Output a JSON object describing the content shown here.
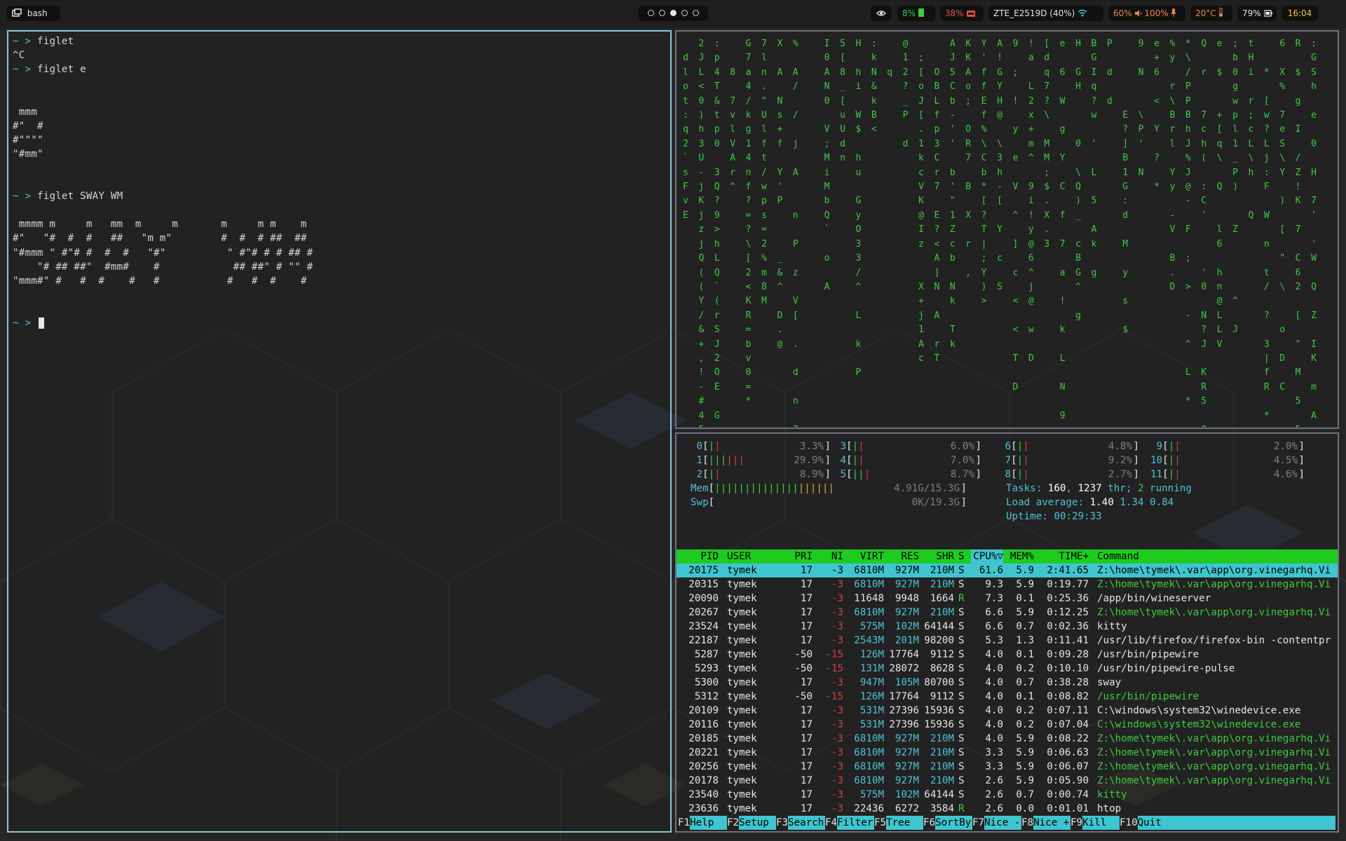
{
  "topbar": {
    "window_title": "bash",
    "workspaces": [
      {
        "active": false
      },
      {
        "active": false
      },
      {
        "active": true
      },
      {
        "active": false
      },
      {
        "active": false
      }
    ],
    "status": {
      "cpu": "8%",
      "mem": "38%",
      "network": "ZTE_E2519D (40%)",
      "volume_brightness": "60%",
      "volume": "100%",
      "temperature": "20°C",
      "battery": "79%",
      "clock": "16:04"
    },
    "colors": {
      "green": "#3fcb3f",
      "red": "#e0504c",
      "orange": "#e8884a",
      "accent": "#4fc1d7"
    }
  },
  "left_terminal": {
    "lines": [
      {
        "prompt": "~ > ",
        "text": "figlet"
      },
      {
        "prompt": "",
        "text": "^C"
      },
      {
        "prompt": "~ > ",
        "text": "figlet e"
      },
      {
        "prompt": "",
        "text": ""
      },
      {
        "prompt": "",
        "text": ""
      },
      {
        "prompt": "",
        "text": " mmm"
      },
      {
        "prompt": "",
        "text": "#\"  #"
      },
      {
        "prompt": "",
        "text": "#\"\"\"\""
      },
      {
        "prompt": "",
        "text": "\"#mm\""
      },
      {
        "prompt": "",
        "text": ""
      },
      {
        "prompt": "",
        "text": ""
      },
      {
        "prompt": "~ > ",
        "text": "figlet SWAY WM"
      },
      {
        "prompt": "",
        "text": ""
      },
      {
        "prompt": "",
        "text": " mmmm m     m   mm  m     m       m     m m    m"
      },
      {
        "prompt": "",
        "text": "#\"   \"#  #  #   ##   \"m m\"        #  #  # ##  ##"
      },
      {
        "prompt": "",
        "text": "\"#mmm \" #\"# #  #  #   \"#\"          \" #\"# # # ## #"
      },
      {
        "prompt": "",
        "text": "    \"# ## ##\"  #mm#    #            ## ##\" # \"\" #"
      },
      {
        "prompt": "",
        "text": "\"mmm#\" #   #  #    #   #           #   #  #    #"
      },
      {
        "prompt": "",
        "text": ""
      },
      {
        "prompt": "",
        "text": ""
      },
      {
        "prompt": "~ > ",
        "text": ""
      }
    ]
  },
  "matrix": {
    "columns": [
      " dlot:q2`sFvE",
      "2JL<0)h3U-jKjzjQ((Y/&+,!-#45",
      ":p4T&tp0 3Q?9>hLQ`(rSJ2OE G",
      "  8 7vlVAr^ ",
      "G7a4/kg14nf?=?\\[2<KR=bv0=*",
      "7ln.\"Ulft/wps=2%m8M",
      "X A Ns+f Y'P   _&^ D.@",
      "% A/ / j A  n P z V[ . d n 7 H",
      " ",
      "I0AN0 V;MiMbQ` o A",
      "5[8_[uUdn",
      "H hi W$ hu GyO33/^ L k P",
      ":kN&kB<",
      "  q ",
      "@12?_P d ",
      " ;[oJ[.1kcVK@Iz  X+j1Ac",
      "  OBLfp3Cr7 E?<A]N A rT",
      "AJ5Cb-'' b'\"1Zcb Nk Tk ",
      "KKAo; OR7 B X r ,",
      "Y'ffEf%\\Cb*[?T|;Y)>",
      "A!GYH@ \\3h-[ Y c S",
      "9 ; ! y e V ^ ] c < < T D",
      "!a L2x+m^ 9i!y@6^j@ w D",
      "[dq7?\\ MM;$.X.3",
      "e 6 W g Y C f 7 a ! k L N 9 8",
      "H GH   0 \\Q)_ cBG^ g",
      "BGIq?w ' L 5 Ak g",
      "P d d ",
      "     E?]B1G:d M y s $",
      "9 N  \\P' N",
      "e+6 < Y ? *",
      "%y r\\Brl Yy -V B.D",
      "*\\/PPBhJ%J@- F ; > - ^ L *",
      "Q r  7ch( :C'   '0 N?J KR5 8",
      "e $  +[q\\ Q  l6 hn@LLV",
      ";b0gwpl1_P)  Z    ^ J",
      "tHi r;cL\\h  Q",
      "  * [w?Lj:F W n t/ ? 3|fR * l ? +",
      "6 X% 7eS\\Y ) [ \" \\  o D C  ; ,",
      "R $ g I /Z!K 7 C62 [ \" M 5 5 D @",
      ":GSh e 0 H 7' 'W Q Z IK m A O w +"
    ]
  },
  "htop": {
    "cpus": [
      {
        "id": "0",
        "bar": "||",
        "pct": "3.3%"
      },
      {
        "id": "1",
        "bar": "||||||",
        "pct": "29.9%"
      },
      {
        "id": "2",
        "bar": "||",
        "pct": "8.9%"
      },
      {
        "id": "3",
        "bar": "||",
        "pct": "6.0%"
      },
      {
        "id": "4",
        "bar": "||",
        "pct": "7.0%"
      },
      {
        "id": "5",
        "bar": "|||",
        "pct": "8.7%"
      },
      {
        "id": "6",
        "bar": "||",
        "pct": "4.8%"
      },
      {
        "id": "7",
        "bar": "||",
        "pct": "9.2%"
      },
      {
        "id": "8",
        "bar": "||",
        "pct": "2.7%"
      },
      {
        "id": "9",
        "bar": "||",
        "pct": "2.0%"
      },
      {
        "id": "10",
        "bar": "||",
        "pct": "4.5%"
      },
      {
        "id": "11",
        "bar": "||",
        "pct": "4.6%"
      }
    ],
    "mem": {
      "label": "Mem",
      "value": "4.91G/15.3G"
    },
    "swp": {
      "label": "Swp",
      "value": "0K/19.3G"
    },
    "tasks": {
      "label": "Tasks:",
      "count": "160",
      "sep": ",",
      "thr": "1237",
      "thr_label": "thr;",
      "running": "2",
      "running_label": "running"
    },
    "load": {
      "label": "Load average:",
      "v1": "1.40",
      "v2": "1.34",
      "v3": "0.84"
    },
    "uptime": {
      "label": "Uptime:",
      "value": "00:29:33"
    },
    "columns": [
      "PID",
      "USER",
      "PRI",
      "NI",
      "VIRT",
      "RES",
      "SHR",
      "S",
      "CPU%▽",
      "MEM%",
      "TIME+",
      "Command"
    ],
    "processes": [
      {
        "pid": "20175",
        "user": "tymek",
        "pri": "17",
        "ni": "-3",
        "virt": "6810M",
        "res": "927M",
        "shr": "210M",
        "s": "S",
        "cpu": "61.6",
        "mem": "5.9",
        "time": "2:41.65",
        "cmd": "Z:\\home\\tymek\\.var\\app\\org.vinegarhq.Vi",
        "cmd_color": "sel"
      },
      {
        "pid": "20315",
        "user": "tymek",
        "pri": "17",
        "ni": "-3",
        "virt": "6810M",
        "res": "927M",
        "shr": "210M",
        "s": "S",
        "cpu": "9.3",
        "mem": "5.9",
        "time": "0:19.77",
        "cmd": "Z:\\home\\tymek\\.var\\app\\org.vinegarhq.Vi",
        "cmd_color": "green"
      },
      {
        "pid": "20090",
        "user": "tymek",
        "pri": "17",
        "ni": "-3",
        "virt": "11648",
        "res": "9948",
        "shr": "1664",
        "s": "R",
        "cpu": "7.3",
        "mem": "0.1",
        "time": "0:25.36",
        "cmd": "/app/bin/wineserver",
        "cmd_color": "white"
      },
      {
        "pid": "20267",
        "user": "tymek",
        "pri": "17",
        "ni": "-3",
        "virt": "6810M",
        "res": "927M",
        "shr": "210M",
        "s": "S",
        "cpu": "6.6",
        "mem": "5.9",
        "time": "0:12.25",
        "cmd": "Z:\\home\\tymek\\.var\\app\\org.vinegarhq.Vi",
        "cmd_color": "green"
      },
      {
        "pid": "23524",
        "user": "tymek",
        "pri": "17",
        "ni": "-3",
        "virt": "575M",
        "res": "102M",
        "shr": "64144",
        "s": "S",
        "cpu": "6.6",
        "mem": "0.7",
        "time": "0:02.36",
        "cmd": "kitty",
        "cmd_color": "white"
      },
      {
        "pid": "22187",
        "user": "tymek",
        "pri": "17",
        "ni": "-3",
        "virt": "2543M",
        "res": "201M",
        "shr": "98200",
        "s": "S",
        "cpu": "5.3",
        "mem": "1.3",
        "time": "0:11.41",
        "cmd": "/usr/lib/firefox/firefox-bin -contentpr",
        "cmd_color": "white"
      },
      {
        "pid": "5287",
        "user": "tymek",
        "pri": "-50",
        "ni": "-15",
        "virt": "126M",
        "res": "17764",
        "shr": "9112",
        "s": "S",
        "cpu": "4.0",
        "mem": "0.1",
        "time": "0:09.28",
        "cmd": "/usr/bin/pipewire",
        "cmd_color": "white"
      },
      {
        "pid": "5293",
        "user": "tymek",
        "pri": "-50",
        "ni": "-15",
        "virt": "131M",
        "res": "28072",
        "shr": "8628",
        "s": "S",
        "cpu": "4.0",
        "mem": "0.2",
        "time": "0:10.10",
        "cmd": "/usr/bin/pipewire-pulse",
        "cmd_color": "white"
      },
      {
        "pid": "5300",
        "user": "tymek",
        "pri": "17",
        "ni": "-3",
        "virt": "947M",
        "res": "105M",
        "shr": "80700",
        "s": "S",
        "cpu": "4.0",
        "mem": "0.7",
        "time": "0:38.28",
        "cmd": "sway",
        "cmd_color": "white"
      },
      {
        "pid": "5312",
        "user": "tymek",
        "pri": "-50",
        "ni": "-15",
        "virt": "126M",
        "res": "17764",
        "shr": "9112",
        "s": "S",
        "cpu": "4.0",
        "mem": "0.1",
        "time": "0:08.82",
        "cmd": "/usr/bin/pipewire",
        "cmd_color": "green"
      },
      {
        "pid": "20109",
        "user": "tymek",
        "pri": "17",
        "ni": "-3",
        "virt": "531M",
        "res": "27396",
        "shr": "15936",
        "s": "S",
        "cpu": "4.0",
        "mem": "0.2",
        "time": "0:07.11",
        "cmd": "C:\\windows\\system32\\winedevice.exe",
        "cmd_color": "white"
      },
      {
        "pid": "20116",
        "user": "tymek",
        "pri": "17",
        "ni": "-3",
        "virt": "531M",
        "res": "27396",
        "shr": "15936",
        "s": "S",
        "cpu": "4.0",
        "mem": "0.2",
        "time": "0:07.04",
        "cmd": "C:\\windows\\system32\\winedevice.exe",
        "cmd_color": "green"
      },
      {
        "pid": "20185",
        "user": "tymek",
        "pri": "17",
        "ni": "-3",
        "virt": "6810M",
        "res": "927M",
        "shr": "210M",
        "s": "S",
        "cpu": "4.0",
        "mem": "5.9",
        "time": "0:08.22",
        "cmd": "Z:\\home\\tymek\\.var\\app\\org.vinegarhq.Vi",
        "cmd_color": "green"
      },
      {
        "pid": "20221",
        "user": "tymek",
        "pri": "17",
        "ni": "-3",
        "virt": "6810M",
        "res": "927M",
        "shr": "210M",
        "s": "S",
        "cpu": "3.3",
        "mem": "5.9",
        "time": "0:06.63",
        "cmd": "Z:\\home\\tymek\\.var\\app\\org.vinegarhq.Vi",
        "cmd_color": "green"
      },
      {
        "pid": "20256",
        "user": "tymek",
        "pri": "17",
        "ni": "-3",
        "virt": "6810M",
        "res": "927M",
        "shr": "210M",
        "s": "S",
        "cpu": "3.3",
        "mem": "5.9",
        "time": "0:06.07",
        "cmd": "Z:\\home\\tymek\\.var\\app\\org.vinegarhq.Vi",
        "cmd_color": "green"
      },
      {
        "pid": "20178",
        "user": "tymek",
        "pri": "17",
        "ni": "-3",
        "virt": "6810M",
        "res": "927M",
        "shr": "210M",
        "s": "S",
        "cpu": "2.6",
        "mem": "5.9",
        "time": "0:05.90",
        "cmd": "Z:\\home\\tymek\\.var\\app\\org.vinegarhq.Vi",
        "cmd_color": "green"
      },
      {
        "pid": "23540",
        "user": "tymek",
        "pri": "17",
        "ni": "-3",
        "virt": "575M",
        "res": "102M",
        "shr": "64144",
        "s": "S",
        "cpu": "2.6",
        "mem": "0.7",
        "time": "0:00.74",
        "cmd": "kitty",
        "cmd_color": "green"
      },
      {
        "pid": "23636",
        "user": "tymek",
        "pri": "17",
        "ni": "-3",
        "virt": "22436",
        "res": "6272",
        "shr": "3584",
        "s": "R",
        "cpu": "2.6",
        "mem": "0.0",
        "time": "0:01.01",
        "cmd": "htop",
        "cmd_color": "white"
      }
    ],
    "function_keys": [
      {
        "key": "F1",
        "label": "Help  "
      },
      {
        "key": "F2",
        "label": "Setup "
      },
      {
        "key": "F3",
        "label": "Search"
      },
      {
        "key": "F4",
        "label": "Filter"
      },
      {
        "key": "F5",
        "label": "Tree  "
      },
      {
        "key": "F6",
        "label": "SortBy"
      },
      {
        "key": "F7",
        "label": "Nice -"
      },
      {
        "key": "F8",
        "label": "Nice +"
      },
      {
        "key": "F9",
        "label": "Kill  "
      },
      {
        "key": "F10",
        "label": "Quit"
      }
    ]
  }
}
